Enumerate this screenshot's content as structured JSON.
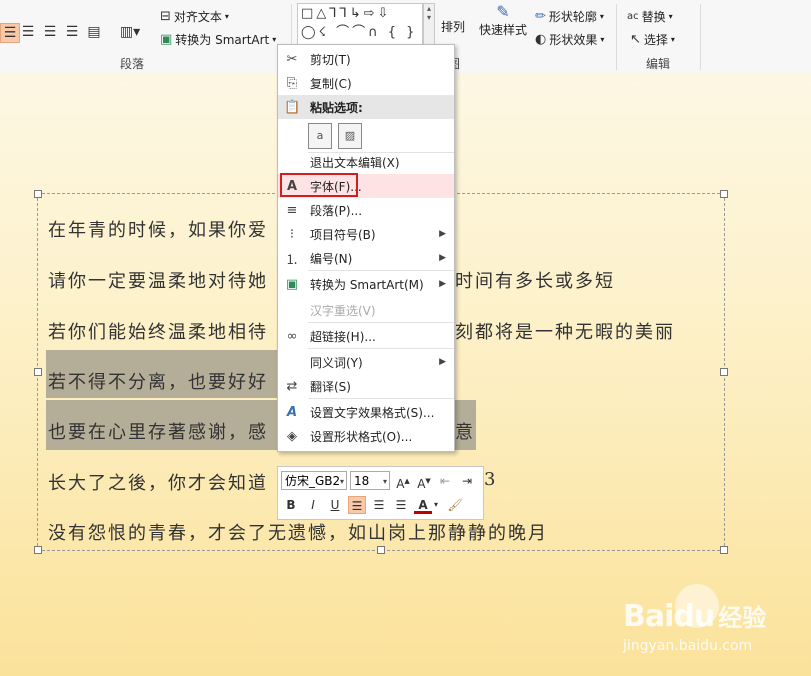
{
  "ribbon": {
    "align_text": "对齐文本",
    "convert_smartart": "转换为 SmartArt",
    "group_paragraph": "段落",
    "group_drawing_suffix": "图",
    "arrange": "排列",
    "quick_styles": "快速样式",
    "shape_outline": "形状轮廓",
    "shape_effects": "形状效果",
    "replace": "替换",
    "select": "选择",
    "group_editing": "编辑",
    "shape_gallery_row1": "□△⅂⅂↳⇨⇩",
    "shape_gallery_row2": "◯☇ ⌒⌒∩ { }"
  },
  "slide": {
    "lines": [
      "在年青的时候，如果你爱",
      "请你一定要温柔地对待她",
      "若你们能始终温柔地相待",
      "若不得不分离，也要好好",
      "也要在心里存著感谢，感",
      "长大了之後，你才会知道",
      "没有怨恨的青春，才会了无遗憾，如山岗上那静静的晚月"
    ],
    "line2_tail": "时间有多长或多短",
    "line3_tail": "刻都将是一种无暇的美丽",
    "line5_tail": "意",
    "line6_tail": "3"
  },
  "context_menu": {
    "items": [
      {
        "label": "剪切(T)",
        "icon": "scissors-icon"
      },
      {
        "label": "复制(C)",
        "icon": "copy-icon"
      },
      {
        "label": "粘贴选项:",
        "icon": "clipboard-icon"
      },
      {
        "label": "退出文本编辑(X)",
        "icon": ""
      },
      {
        "label": "字体(F)...",
        "icon": "font-icon"
      },
      {
        "label": "段落(P)...",
        "icon": "paragraph-icon"
      },
      {
        "label": "项目符号(B)",
        "icon": "bullets-icon"
      },
      {
        "label": "编号(N)",
        "icon": "numbering-icon"
      },
      {
        "label": "转换为 SmartArt(M)",
        "icon": "smartart-icon"
      },
      {
        "label": "汉字重选(V)",
        "icon": ""
      },
      {
        "label": "超链接(H)...",
        "icon": "hyperlink-icon"
      },
      {
        "label": "同义词(Y)",
        "icon": ""
      },
      {
        "label": "翻译(S)",
        "icon": "translate-icon"
      },
      {
        "label": "设置文字效果格式(S)...",
        "icon": "text-effects-icon"
      },
      {
        "label": "设置形状格式(O)...",
        "icon": "shape-format-icon"
      }
    ]
  },
  "mini_toolbar": {
    "font_name": "仿宋_GB2",
    "font_size": "18",
    "bold": "B",
    "italic": "I",
    "underline": "U",
    "font_color": "A"
  },
  "watermark": {
    "brand": "Bai",
    "brand2": "du",
    "cn": "经验",
    "url": "jingyan.baidu.com"
  }
}
